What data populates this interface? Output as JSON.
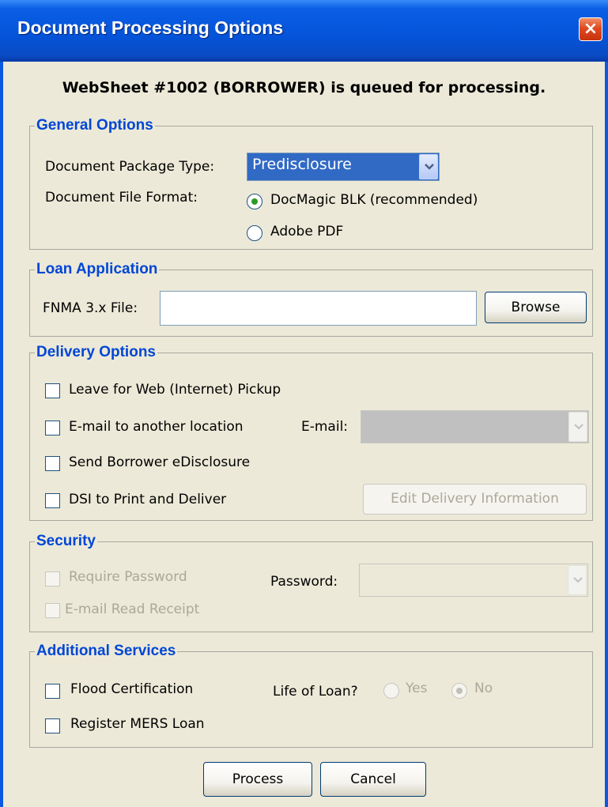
{
  "window": {
    "title": "Document Processing Options",
    "close_glyph": "×"
  },
  "queued_message": "WebSheet #1002 (BORROWER) is queued for processing.",
  "general": {
    "legend": "General Options",
    "package_type_label": "Document Package Type:",
    "package_type_value": "Predisclosure",
    "file_format_label": "Document File Format:",
    "format_options": [
      "DocMagic BLK (recommended)",
      "Adobe PDF"
    ],
    "format_selected": "DocMagic BLK (recommended)"
  },
  "loan": {
    "legend": "Loan Application",
    "fnma_label": "FNMA 3.x File:",
    "fnma_value": "",
    "browse_label": "Browse"
  },
  "delivery": {
    "legend": "Delivery Options",
    "web_pickup_label": "Leave for Web (Internet) Pickup",
    "email_other_label": "E-mail to another location",
    "email_label": "E-mail:",
    "email_value": "",
    "edisclosure_label": "Send Borrower eDisclosure",
    "dsi_label": "DSI to Print and Deliver",
    "edit_delivery_label": "Edit Delivery Information"
  },
  "security": {
    "legend": "Security",
    "require_password_label": "Require Password",
    "password_label": "Password:",
    "password_value": "",
    "read_receipt_label": "E-mail Read Receipt"
  },
  "additional": {
    "legend": "Additional Services",
    "flood_label": "Flood Certification",
    "life_of_loan_label": "Life of Loan?",
    "yes_label": "Yes",
    "no_label": "No",
    "life_of_loan_selected": "No",
    "mers_label": "Register MERS Loan"
  },
  "footer": {
    "process_label": "Process",
    "cancel_label": "Cancel"
  },
  "colors": {
    "titlebar": "#0553d8",
    "legend": "#0046d5",
    "select_highlight": "#316ac5",
    "dialog_bg": "#ece9d8"
  }
}
